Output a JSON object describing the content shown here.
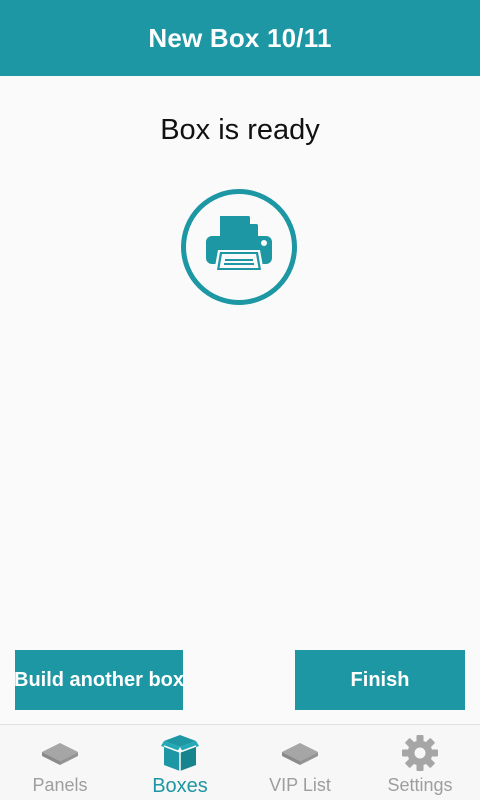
{
  "header": {
    "title": "New Box 10/11"
  },
  "main": {
    "status_text": "Box is ready",
    "icon": "printer-icon"
  },
  "actions": {
    "build_another_label": "Build another box",
    "finish_label": "Finish"
  },
  "tabbar": {
    "items": [
      {
        "label": "Panels",
        "icon": "panel-icon",
        "active": false
      },
      {
        "label": "Boxes",
        "icon": "box-icon",
        "active": true
      },
      {
        "label": "VIP List",
        "icon": "vip-list-icon",
        "active": false
      },
      {
        "label": "Settings",
        "icon": "gear-icon",
        "active": false
      }
    ]
  },
  "colors": {
    "accent": "#1c97a3",
    "inactive_tab": "#9e9e9e",
    "background": "#fafafa"
  }
}
